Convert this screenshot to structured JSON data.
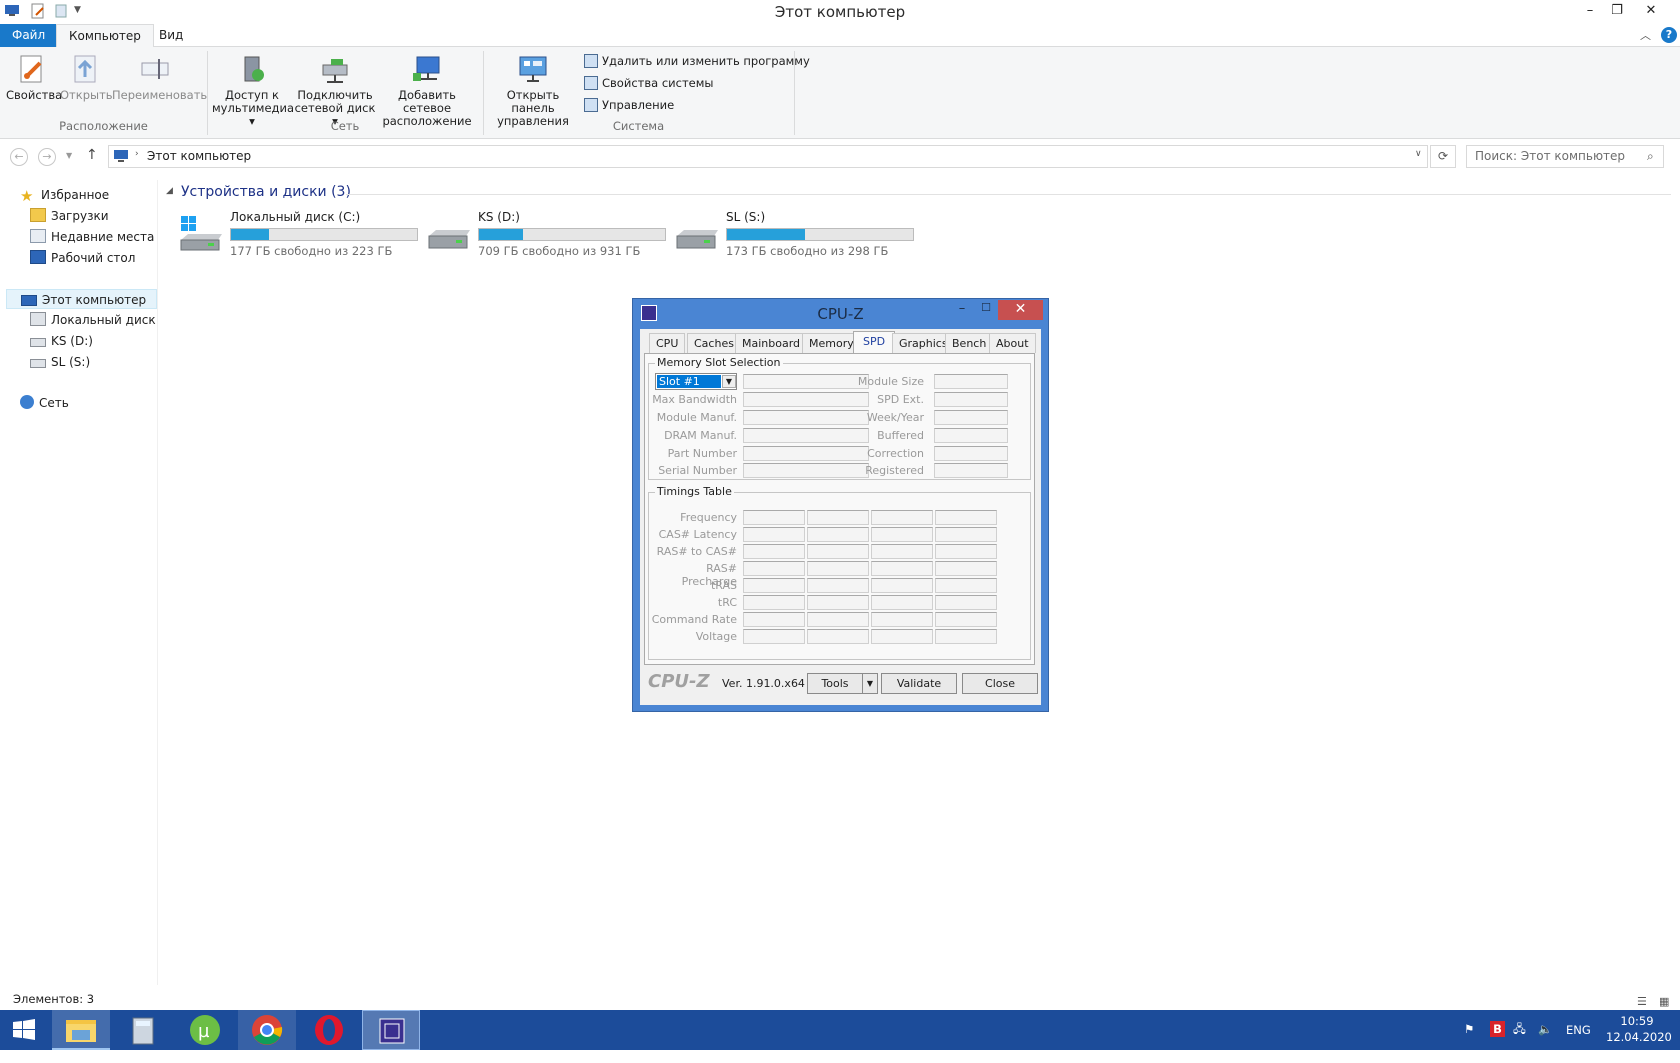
{
  "window": {
    "title": "Этот компьютер"
  },
  "ribbon_tabs": [
    "Файл",
    "Компьютер",
    "Вид"
  ],
  "ribbon": {
    "location": {
      "properties": "Свойства",
      "open": "Открыть",
      "rename": "Переименовать",
      "group_label": "Расположение"
    },
    "network": {
      "media_l1": "Доступ к",
      "media_l2": "мультимедиа",
      "map_l1": "Подключить",
      "map_l2": "сетевой диск",
      "add_l1": "Добавить сетевое",
      "add_l2": "расположение",
      "group_label": "Сеть"
    },
    "system": {
      "cp_l1": "Открыть панель",
      "cp_l2": "управления",
      "uninstall": "Удалить или изменить программу",
      "sysprops": "Свойства системы",
      "manage": "Управление",
      "group_label": "Система"
    }
  },
  "address": {
    "path": "Этот компьютер",
    "search_placeholder": "Поиск: Этот компьютер"
  },
  "nav": {
    "favorites": "Избранное",
    "downloads": "Загрузки",
    "recent": "Недавние места",
    "desktop": "Рабочий стол",
    "this_pc": "Этот компьютер",
    "drive_c": "Локальный диск (C",
    "drive_d": "KS (D:)",
    "drive_s": "SL (S:)",
    "network": "Сеть"
  },
  "section_header": "Устройства и диски (3)",
  "drives": [
    {
      "name": "Локальный диск (C:)",
      "free": "177 ГБ свободно из 223 ГБ",
      "used_fraction": 0.206
    },
    {
      "name": "KS (D:)",
      "free": "709 ГБ свободно из 931 ГБ",
      "used_fraction": 0.238
    },
    {
      "name": "SL (S:)",
      "free": "173 ГБ свободно из 298 ГБ",
      "used_fraction": 0.419
    }
  ],
  "status": {
    "items": "Элементов: 3"
  },
  "cpuz": {
    "title": "CPU-Z",
    "tabs": [
      "CPU",
      "Caches",
      "Mainboard",
      "Memory",
      "SPD",
      "Graphics",
      "Bench",
      "About"
    ],
    "selected_tab": "SPD",
    "slot_section": "Memory Slot Selection",
    "slot_value": "Slot #1",
    "left_labels": [
      "Max Bandwidth",
      "Module Manuf.",
      "DRAM Manuf.",
      "Part Number",
      "Serial Number"
    ],
    "right_labels": [
      "Module Size",
      "SPD Ext.",
      "Week/Year",
      "Buffered",
      "Correction",
      "Registered"
    ],
    "timings_section": "Timings Table",
    "timing_labels": [
      "Frequency",
      "CAS# Latency",
      "RAS# to CAS#",
      "RAS# Precharge",
      "tRAS",
      "tRC",
      "Command Rate",
      "Voltage"
    ],
    "brand": "CPU-Z",
    "version": "Ver. 1.91.0.x64",
    "tools": "Tools",
    "validate": "Validate",
    "close": "Close"
  },
  "tray": {
    "lang": "ENG",
    "time": "10:59",
    "date": "12.04.2020"
  }
}
